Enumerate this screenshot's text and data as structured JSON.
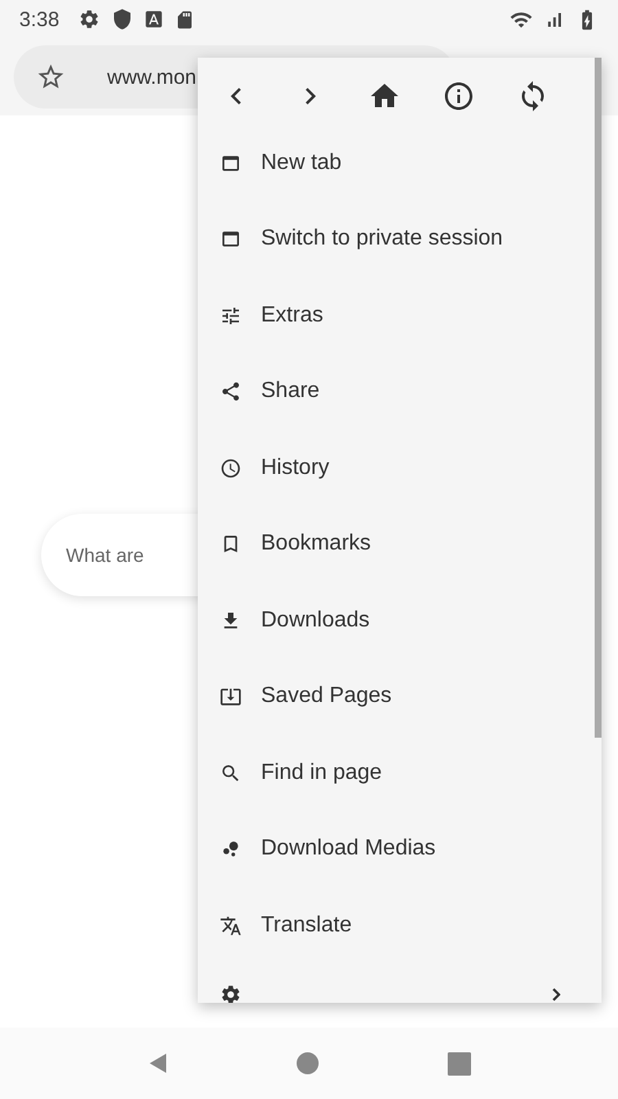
{
  "status_bar": {
    "time": "3:38"
  },
  "address_bar": {
    "url": "www.mon"
  },
  "home": {
    "search": {
      "placeholder": "What are"
    }
  },
  "menu": {
    "items": [
      {
        "label": "New tab"
      },
      {
        "label": "Switch to private session"
      },
      {
        "label": "Extras"
      },
      {
        "label": "Share"
      },
      {
        "label": "History"
      },
      {
        "label": "Bookmarks"
      },
      {
        "label": "Downloads"
      },
      {
        "label": "Saved Pages"
      },
      {
        "label": "Find in page"
      },
      {
        "label": "Download Medias"
      },
      {
        "label": "Translate"
      }
    ]
  }
}
